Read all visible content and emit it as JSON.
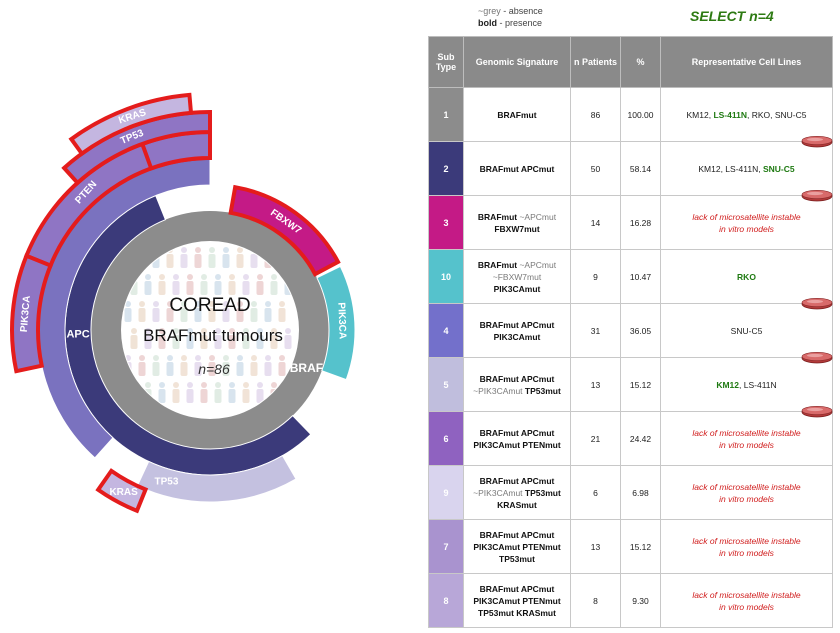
{
  "sunburst": {
    "title": "COREAD",
    "subtitle": "BRAFmut tumours",
    "count": "n=86",
    "colors": {
      "root": "#8c8c8c",
      "apc": "#3b3a7a",
      "fbxw7": "#c41a86",
      "pik3ca_apc": "#7a72bf",
      "pik3ca_fbxw7": "#55c2cc",
      "tp53": "#c4c1e0",
      "pten": "#8f75c4",
      "kras": "#c4b6e0",
      "highlight_stroke": "#e41c1c"
    },
    "labels": {
      "braf": "BRAF",
      "apc": "APC",
      "fbxw7": "FBXW7",
      "pik3ca_outer": "PIK3CA",
      "pik3ca_left": "PIK3CA",
      "tp53_top": "TP53",
      "tp53_bottom": "TP53",
      "pten": "PTEN",
      "kras_top": "KRAS",
      "kras_bottom": "KRAS"
    }
  },
  "legend": {
    "absence_marker": "~grey",
    "absence_text": " - absence",
    "presence_marker": "bold",
    "presence_text": " - presence"
  },
  "select_label": "SELECT n=4",
  "table": {
    "headers": {
      "subtype": "Sub Type",
      "signature": "Genomic Signature",
      "patients": "n Patients",
      "percent": "%",
      "cell_lines": "Representative Cell Lines"
    },
    "rows": [
      {
        "subtype": "1",
        "color": "#8c8c8c",
        "signature": [
          {
            "t": "BRAFmut",
            "s": "b"
          }
        ],
        "patients": "86",
        "percent": "100.00",
        "cell_lines": [
          {
            "t": "KM12, ",
            "s": "p"
          },
          {
            "t": "LS-411N",
            "s": "g"
          },
          {
            "t": ", RKO, SNU-C5",
            "s": "p"
          }
        ],
        "dish": true
      },
      {
        "subtype": "2",
        "color": "#3b3a7a",
        "signature": [
          {
            "t": "BRAFmut APCmut",
            "s": "b"
          }
        ],
        "patients": "50",
        "percent": "58.14",
        "cell_lines": [
          {
            "t": "KM12, LS-411N, ",
            "s": "p"
          },
          {
            "t": "SNU-C5",
            "s": "g"
          }
        ],
        "dish": true
      },
      {
        "subtype": "3",
        "color": "#c41a86",
        "signature": [
          {
            "t": "BRAFmut ",
            "s": "b"
          },
          {
            "t": "~APCmut",
            "s": "g"
          },
          {
            "t": "\nFBXW7mut",
            "s": "b"
          }
        ],
        "patients": "14",
        "percent": "16.28",
        "lack": "lack of microsatellite instable\nin vitro models",
        "dish": false
      },
      {
        "subtype": "10",
        "color": "#55c2cc",
        "signature": [
          {
            "t": "BRAFmut ",
            "s": "b"
          },
          {
            "t": "~APCmut\n~FBXW7mut",
            "s": "g"
          },
          {
            "t": "\nPIK3CAmut",
            "s": "b"
          }
        ],
        "patients": "9",
        "percent": "10.47",
        "cell_lines": [
          {
            "t": "RKO",
            "s": "g"
          }
        ],
        "dish": true
      },
      {
        "subtype": "4",
        "color": "#7370cb",
        "signature": [
          {
            "t": "BRAFmut APCmut\nPIK3CAmut",
            "s": "b"
          }
        ],
        "patients": "31",
        "percent": "36.05",
        "cell_lines": [
          {
            "t": "SNU-C5",
            "s": "p"
          }
        ],
        "dish": true
      },
      {
        "subtype": "5",
        "color": "#c0bedd",
        "signature": [
          {
            "t": "BRAFmut APCmut\n",
            "s": "b"
          },
          {
            "t": "~PIK3CAmut",
            "s": "g"
          },
          {
            "t": " TP53mut",
            "s": "b"
          }
        ],
        "patients": "13",
        "percent": "15.12",
        "cell_lines": [
          {
            "t": "KM12",
            "s": "g"
          },
          {
            "t": ", LS-411N",
            "s": "p"
          }
        ],
        "dish": true
      },
      {
        "subtype": "6",
        "color": "#8f62c0",
        "signature": [
          {
            "t": "BRAFmut APCmut\nPIK3CAmut PTENmut",
            "s": "b"
          }
        ],
        "patients": "21",
        "percent": "24.42",
        "lack": "lack of microsatellite instable\nin vitro models",
        "dish": false
      },
      {
        "subtype": "9",
        "color": "#d9d4ee",
        "signature": [
          {
            "t": "BRAFmut APCmut\n",
            "s": "b"
          },
          {
            "t": "~PIK3CAmut",
            "s": "g"
          },
          {
            "t": " TP53mut\nKRASmut",
            "s": "b"
          }
        ],
        "patients": "6",
        "percent": "6.98",
        "lack": "lack of microsatellite instable\nin vitro models",
        "dish": false
      },
      {
        "subtype": "7",
        "color": "#a993cf",
        "signature": [
          {
            "t": "BRAFmut APCmut\nPIK3CAmut PTENmut\nTP53mut",
            "s": "b"
          }
        ],
        "patients": "13",
        "percent": "15.12",
        "lack": "lack of microsatellite instable\nin vitro models",
        "dish": false
      },
      {
        "subtype": "8",
        "color": "#b8a7d8",
        "signature": [
          {
            "t": "BRAFmut APCmut\nPIK3CAmut PTENmut\nTP53mut KRASmut",
            "s": "b"
          }
        ],
        "patients": "8",
        "percent": "9.30",
        "lack": "lack of microsatellite instable\nin vitro models",
        "dish": false
      }
    ]
  }
}
